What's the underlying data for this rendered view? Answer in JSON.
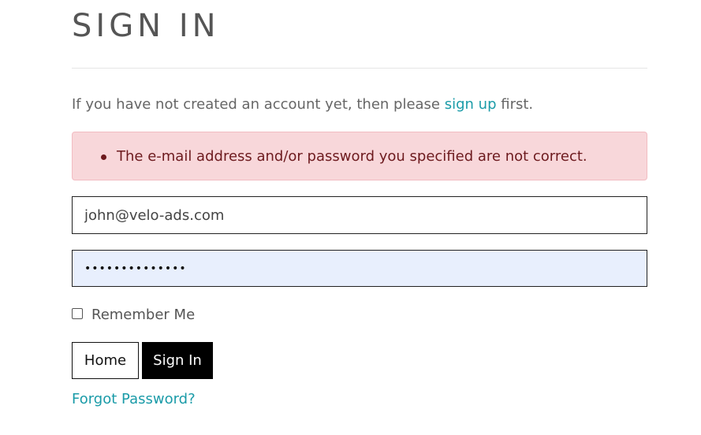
{
  "page": {
    "title": "SIGN IN"
  },
  "intro": {
    "prefix": "If you have not created an account yet, then please ",
    "link_text": "sign up",
    "suffix": " first."
  },
  "error": {
    "messages": [
      "The e-mail address and/or password you specified are not correct."
    ]
  },
  "form": {
    "email_value": "john@velo-ads.com",
    "password_masked": "••••••••••••••",
    "remember_label": "Remember Me",
    "remember_checked": false
  },
  "buttons": {
    "home_label": "Home",
    "signin_label": "Sign In"
  },
  "links": {
    "forgot_password": "Forgot Password?"
  },
  "colors": {
    "link": "#1a9ba8",
    "error_bg": "#f8d7da",
    "error_text": "#6d1a1e",
    "password_bg": "#e8effd"
  }
}
